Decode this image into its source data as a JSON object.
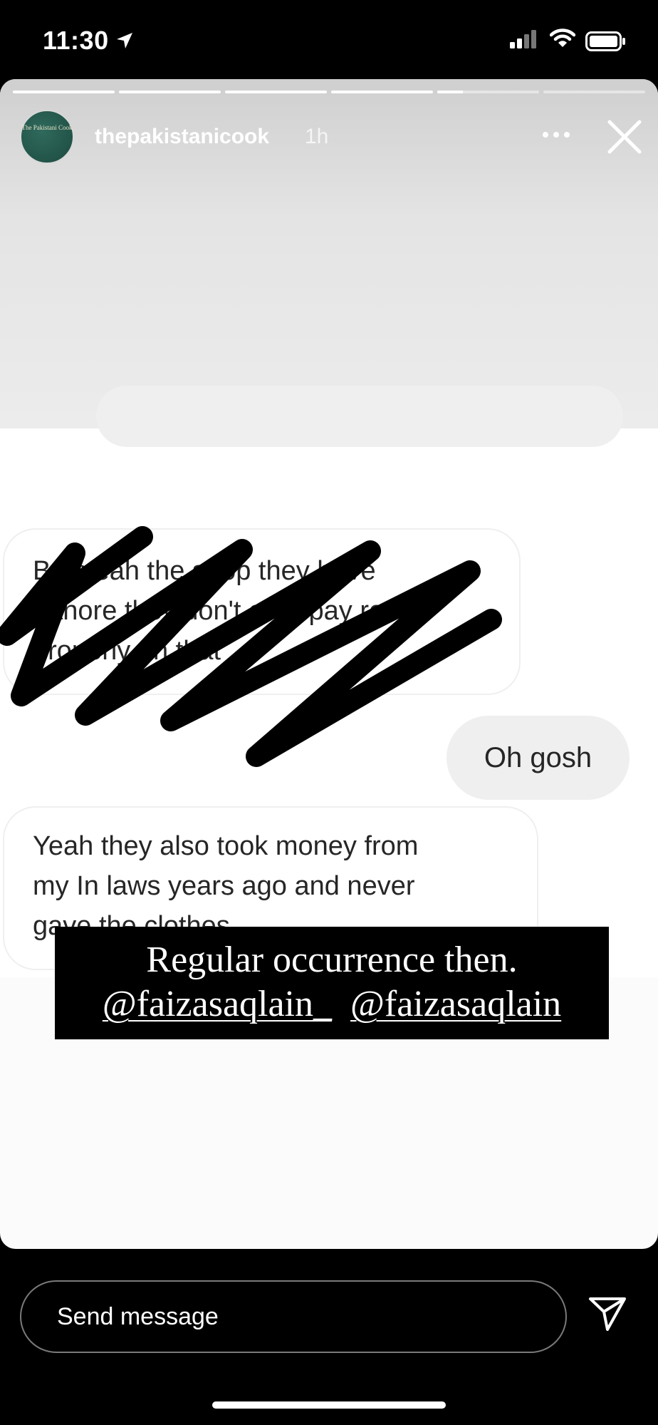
{
  "status_bar": {
    "time": "11:30"
  },
  "story": {
    "username": "thepakistanicook",
    "time_ago": "1h",
    "avatar_text": "The Pakistani Cook",
    "progress_segments": [
      1,
      1,
      1,
      1,
      0.25,
      0
    ]
  },
  "chat": {
    "bubble_1_line1": "But yeah the shop they have",
    "bubble_1_line2": "Lahore they don't ever pay rent",
    "bubble_1_line3": "properly on that",
    "bubble_2": "Oh gosh",
    "bubble_3_line1": "Yeah they also took money from",
    "bubble_3_line2": "my In laws years ago and never",
    "bubble_3_line3": "gave the clothes"
  },
  "caption": {
    "line1": "Regular occurrence then.",
    "mention1": "@faizasaqlain_",
    "mention2": "@faizasaqlain"
  },
  "footer": {
    "send_placeholder": "Send message"
  },
  "colors": {
    "bubble_grey": "#efefef",
    "accent": "#ffffff",
    "background": "#000000"
  },
  "icons": [
    "location-arrow-icon",
    "signal-icon",
    "wifi-icon",
    "battery-icon",
    "more-icon",
    "close-icon",
    "send-icon"
  ]
}
